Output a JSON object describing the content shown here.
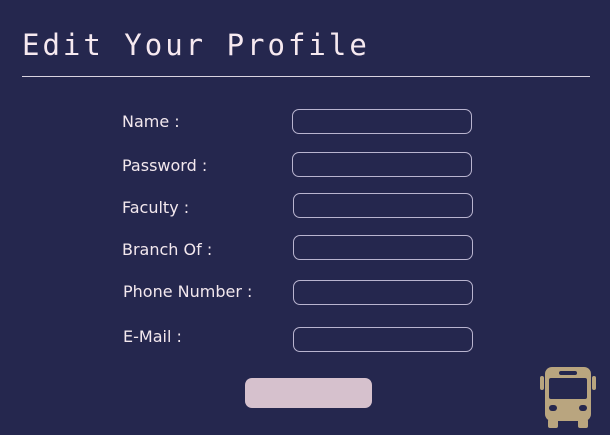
{
  "header": {
    "title": "Edit Your Profile"
  },
  "form": {
    "fields": [
      {
        "label": "Name :",
        "value": "",
        "placeholder": ""
      },
      {
        "label": "Password :",
        "value": "",
        "placeholder": ""
      },
      {
        "label": "Faculty :",
        "value": "",
        "placeholder": ""
      },
      {
        "label": "Branch Of :",
        "value": "",
        "placeholder": ""
      },
      {
        "label": "Phone Number :",
        "value": "",
        "placeholder": ""
      },
      {
        "label": "E-Mail :",
        "value": "",
        "placeholder": ""
      }
    ],
    "submit_label": ""
  },
  "icons": {
    "bus": "bus-icon"
  },
  "colors": {
    "background": "#25274e",
    "text": "#f3e8ee",
    "button": "#d6c1cd",
    "icon": "#b9a57f"
  }
}
